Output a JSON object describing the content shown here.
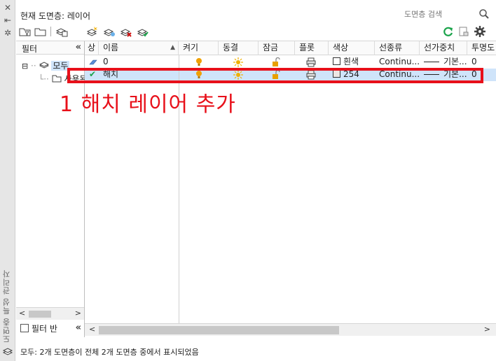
{
  "side_strip": {
    "close_glyph": "✕",
    "autohide_glyph": "⇤",
    "settings_glyph": "✲",
    "title": "도면층 특성 관리자"
  },
  "header": {
    "current_layer_label": "현재 도면층: 레이어",
    "search_placeholder": "도면층 검색"
  },
  "filter_pane": {
    "header_label": "필터",
    "collapse_glyph": "«",
    "tree": [
      {
        "label": "모두",
        "expander": "⊟"
      },
      {
        "label": "사용된"
      }
    ],
    "invert_label": "필터 반",
    "left_arrow": "<",
    "right_arrow": ">"
  },
  "grid": {
    "columns": {
      "status": "상",
      "name": "이름",
      "on": "켜기",
      "freeze": "동결",
      "lock": "잠금",
      "plot": "플롯",
      "color": "색상",
      "linetype": "선종류",
      "lineweight": "선가중치",
      "transparency": "투명도"
    },
    "rows": [
      {
        "name": "0",
        "color_name": "흰색",
        "color_hex": "#ffffff",
        "linetype": "Continu...",
        "lineweight": "기본...",
        "transparency": "0",
        "current": false
      },
      {
        "name": "해치",
        "color_name": "254",
        "color_hex": "#ece6e3",
        "linetype": "Continu...",
        "lineweight": "기본...",
        "transparency": "0",
        "current": true
      }
    ],
    "current_glyph": "✔",
    "sort_glyph": "▲",
    "scroll_left": "<",
    "scroll_right": ">"
  },
  "annotation": {
    "text": "1 해치 레이어 추가",
    "color": "#e8101a"
  },
  "status_bar": {
    "text": "모두: 2개 도면층이 전체 2개 도면층 중에서 표시되었음"
  },
  "colors": {
    "selected_row": "#cfe4fa",
    "bulb": "#f0a000",
    "sun": "#f0b000",
    "lock": "#e8a000",
    "refresh": "#1aa34a"
  }
}
